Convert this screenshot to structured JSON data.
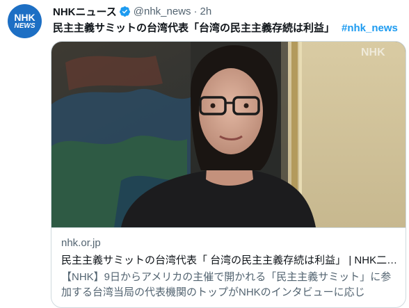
{
  "account": {
    "avatar_line1": "NHK",
    "avatar_line2": "NEWS",
    "display_name": "NHKニュース",
    "handle": "@nhk_news",
    "separator": "·",
    "time": "2h"
  },
  "tweet": {
    "text": "民主主義サミットの台湾代表「台湾の民主主義存続は利益」",
    "hashtag": "#nhk_news"
  },
  "card": {
    "watermark": "NHK",
    "domain": "nhk.or.jp",
    "title": "民主主義サミットの台湾代表「 台湾の民主主義存続は利益」 | NHK二…",
    "description": "【NHK】9日からアメリカの主催で開かれる「民主主義サミット」に参加する台湾当局の代表機関のトップがNHKのインタビューに応じ「台…"
  },
  "colors": {
    "accent": "#1d9bf0",
    "avatar_bg": "#1d6fc4",
    "secondary_text": "#536471",
    "border": "#cfd9de"
  },
  "icons": [
    "verified-badge-icon"
  ]
}
